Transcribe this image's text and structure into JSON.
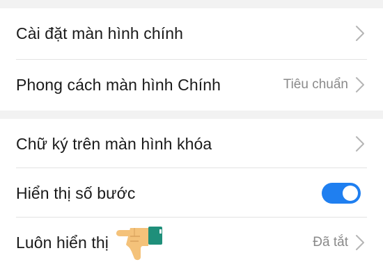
{
  "settings": {
    "group1": [
      {
        "label": "Cài đặt màn hình chính",
        "value": ""
      },
      {
        "label": "Phong cách màn hình Chính",
        "value": "Tiêu chuẩn"
      }
    ],
    "group2": [
      {
        "label": "Chữ ký trên màn hình khóa",
        "value": ""
      },
      {
        "label": "Hiển thị số bước",
        "toggle_on": true
      },
      {
        "label": "Luôn hiển thị",
        "value": "Đã tắt"
      }
    ]
  },
  "colors": {
    "accent": "#1f7ff0",
    "background": "#f2f2f2",
    "text": "#1a1a1a",
    "secondary_text": "#8a8a8a",
    "hand_skin": "#f4c27a",
    "hand_cuff": "#1f8f7a"
  },
  "icons": {
    "chevron": "chevron-right-icon",
    "pointer": "pointing-hand-icon"
  }
}
